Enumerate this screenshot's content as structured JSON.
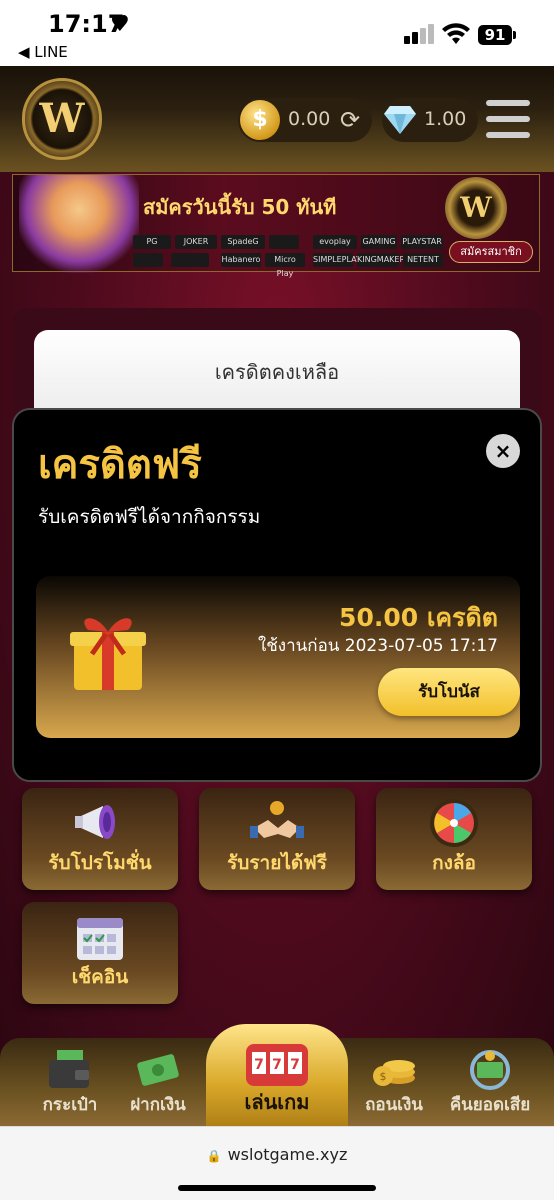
{
  "status_bar": {
    "time": "17:17",
    "heart": "♥",
    "back_app": "◀ LINE",
    "battery": "91"
  },
  "header": {
    "logo_letter": "W",
    "coin_symbol": "$",
    "coin_balance": "0.00",
    "gem_balance": "1.00"
  },
  "banner": {
    "title": "สมัครวันนี้รับ 50 ทันที",
    "logo_letter": "W",
    "signup_label": "สมัครสมาชิก",
    "providers": [
      "PG",
      "JOKER",
      "SpadeG",
      "",
      "evoplay",
      "GAMING",
      "PLAYSTAR",
      "",
      "",
      "",
      "Habanero",
      "Micro Play",
      "SIMPLEPLAY",
      "KINGMAKER",
      "NETENT"
    ]
  },
  "credit_panel": {
    "label": "เครดิตคงเหลือ"
  },
  "modal": {
    "title": "เครดิตฟรี",
    "close_symbol": "×",
    "subtitle": "รับเครดิตฟรีได้จากกิจกรรม",
    "bonus": {
      "amount": "50.00 เครดิต",
      "expiry": "ใช้งานก่อน 2023-07-05 17:17",
      "button": "รับโบนัส"
    }
  },
  "tiles": [
    {
      "label": "รับโปรโมชั่น",
      "icon": "megaphone-icon"
    },
    {
      "label": "รับรายได้ฟรี",
      "icon": "handshake-icon"
    },
    {
      "label": "กงล้อ",
      "icon": "wheel-icon"
    },
    {
      "label": "เช็คอิน",
      "icon": "calendar-icon"
    }
  ],
  "bottom_nav": [
    {
      "label": "กระเป๋า",
      "icon": "wallet-icon"
    },
    {
      "label": "ฝากเงิน",
      "icon": "cash-icon"
    },
    {
      "label": "เล่นเกม",
      "icon": "slot-machine-icon"
    },
    {
      "label": "ถอนเงิน",
      "icon": "coins-icon"
    },
    {
      "label": "คืนยอดเสีย",
      "icon": "refund-icon"
    }
  ],
  "browser": {
    "url": "wslotgame.xyz"
  },
  "colors": {
    "gold": "#f5c442",
    "background": "#4a0a1c",
    "modal": "#000000"
  }
}
